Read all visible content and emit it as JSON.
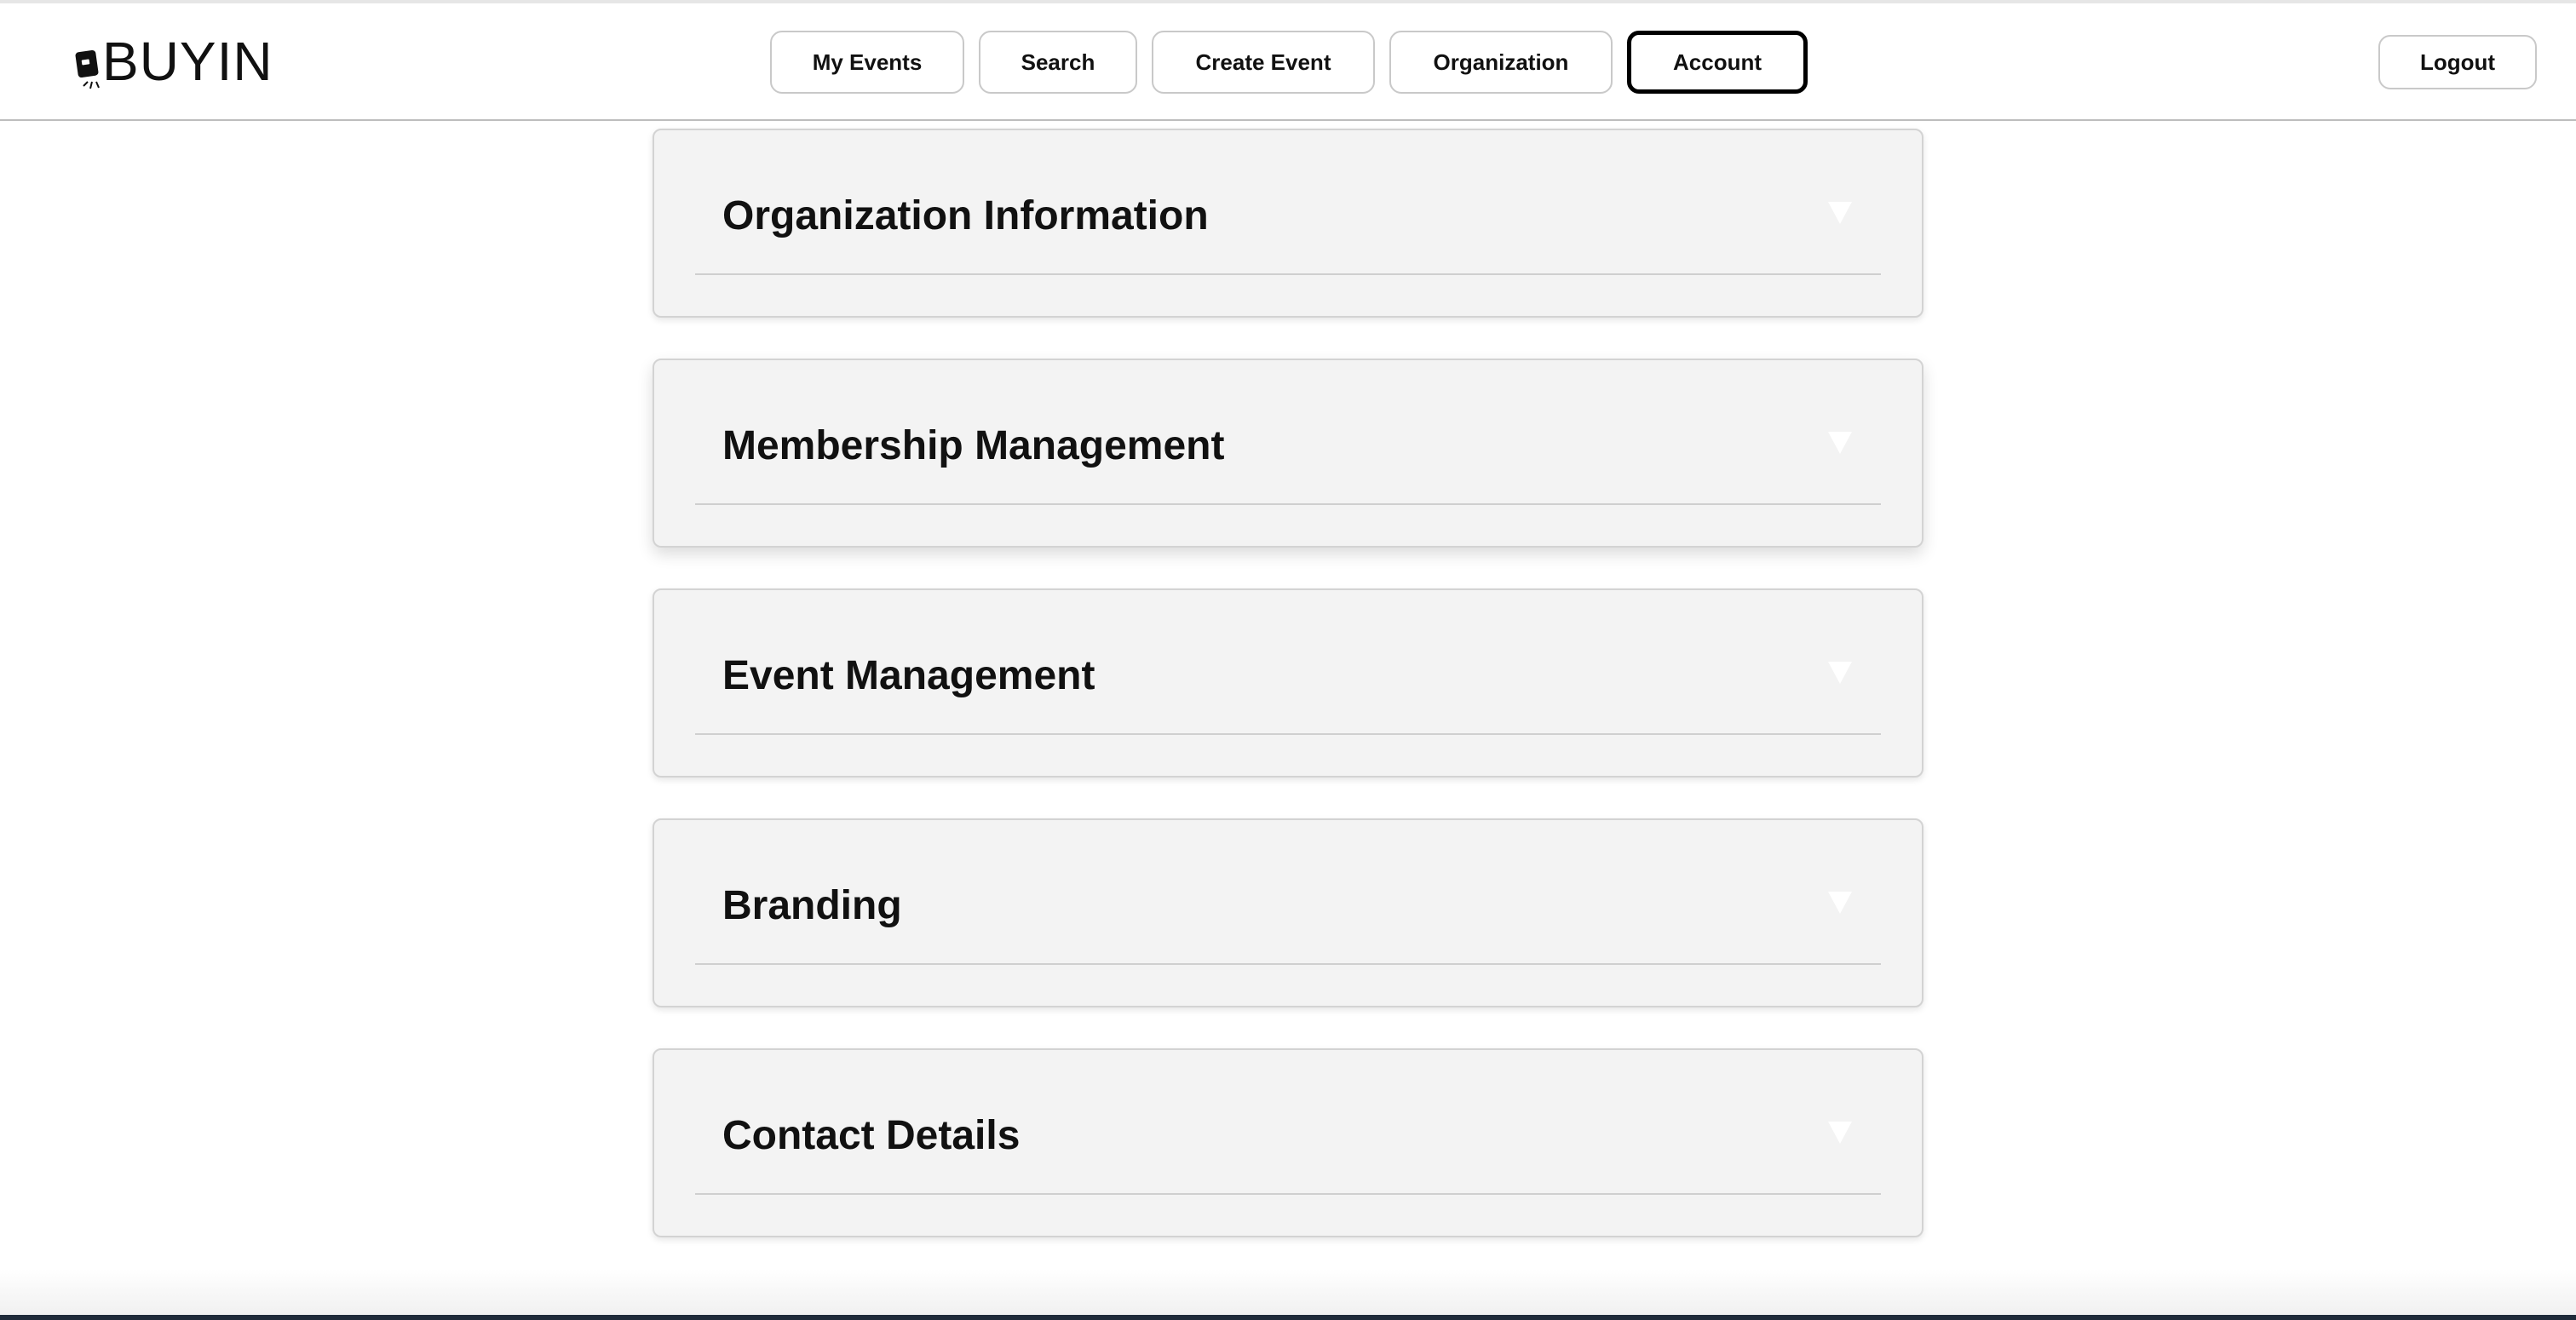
{
  "app": {
    "logo_text": "BUYIN",
    "logo_icon": "ticket-icon"
  },
  "nav": {
    "items": [
      {
        "label": "My Events",
        "active": false
      },
      {
        "label": "Search",
        "active": false
      },
      {
        "label": "Create Event",
        "active": false
      },
      {
        "label": "Organization",
        "active": false
      },
      {
        "label": "Account",
        "active": true
      }
    ],
    "logout_label": "Logout"
  },
  "sections": [
    {
      "title": "Organization Information",
      "icon": "chevron-down-icon"
    },
    {
      "title": "Membership Management",
      "icon": "chevron-down-icon"
    },
    {
      "title": "Event Management",
      "icon": "chevron-down-icon"
    },
    {
      "title": "Branding",
      "icon": "chevron-down-icon"
    },
    {
      "title": "Contact Details",
      "icon": "chevron-down-icon"
    }
  ],
  "colors": {
    "page_background": "#ffffff",
    "section_background": "#f3f3f3",
    "active_border": "#000000"
  }
}
